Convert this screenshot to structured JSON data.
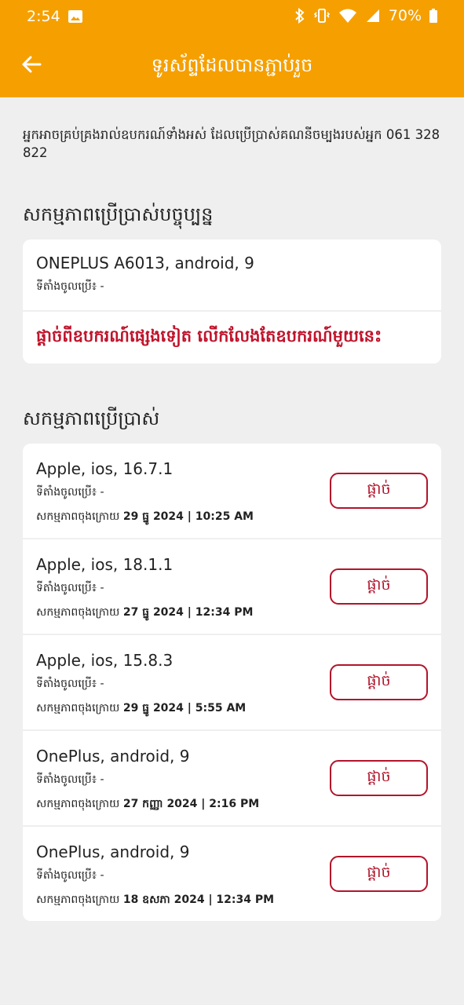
{
  "status_bar": {
    "time": "2:54",
    "battery": "70%"
  },
  "toolbar": {
    "title": "ទូរស័ព្ទដែលបានភ្ជាប់រួច"
  },
  "intro": "អ្នកអាចគ្រប់គ្រងរាល់ឧបករណ៍ទាំងអស់ ដែលប្រើប្រាស់គណនីចម្បងរបស់អ្នក 061 328 822",
  "current_section": {
    "title": "សកម្មភាពប្រើប្រាស់បច្ចុប្បន្ន",
    "device": {
      "name": "ONEPLUS A6013, android, 9",
      "location_label": "ទីតាំងចូលប្រើ៖",
      "location_value": "-"
    },
    "logout_others_label": "ផ្ដាច់ពីឧបករណ៍ផ្សេងទៀត លើកលែងតែឧបករណ៍មួយនេះ"
  },
  "history_section": {
    "title": "សកម្មភាពប្រើប្រាស់",
    "location_label": "ទីតាំងចូលប្រើ៖",
    "last_active_label": "សកម្មភាពចុងក្រោយ",
    "button_label": "ផ្ដាច់",
    "devices": [
      {
        "name": "Apple, ios, 16.7.1",
        "location": "-",
        "last_active": "29 ធ្នូ 2024 | 10:25 AM"
      },
      {
        "name": "Apple, ios, 18.1.1",
        "location": "-",
        "last_active": "27 ធ្នូ 2024 | 12:34 PM"
      },
      {
        "name": "Apple, ios, 15.8.3",
        "location": "-",
        "last_active": "29 ធ្នូ 2024 | 5:55 AM"
      },
      {
        "name": "OnePlus, android, 9",
        "location": "-",
        "last_active": "27 កញ្ញា 2024 | 2:16 PM"
      },
      {
        "name": "OnePlus, android, 9",
        "location": "-",
        "last_active": "18 ឧសភា 2024 | 12:34 PM"
      }
    ]
  },
  "colors": {
    "header": "#f5a000",
    "danger": "#c0132b",
    "background": "#efefef"
  }
}
